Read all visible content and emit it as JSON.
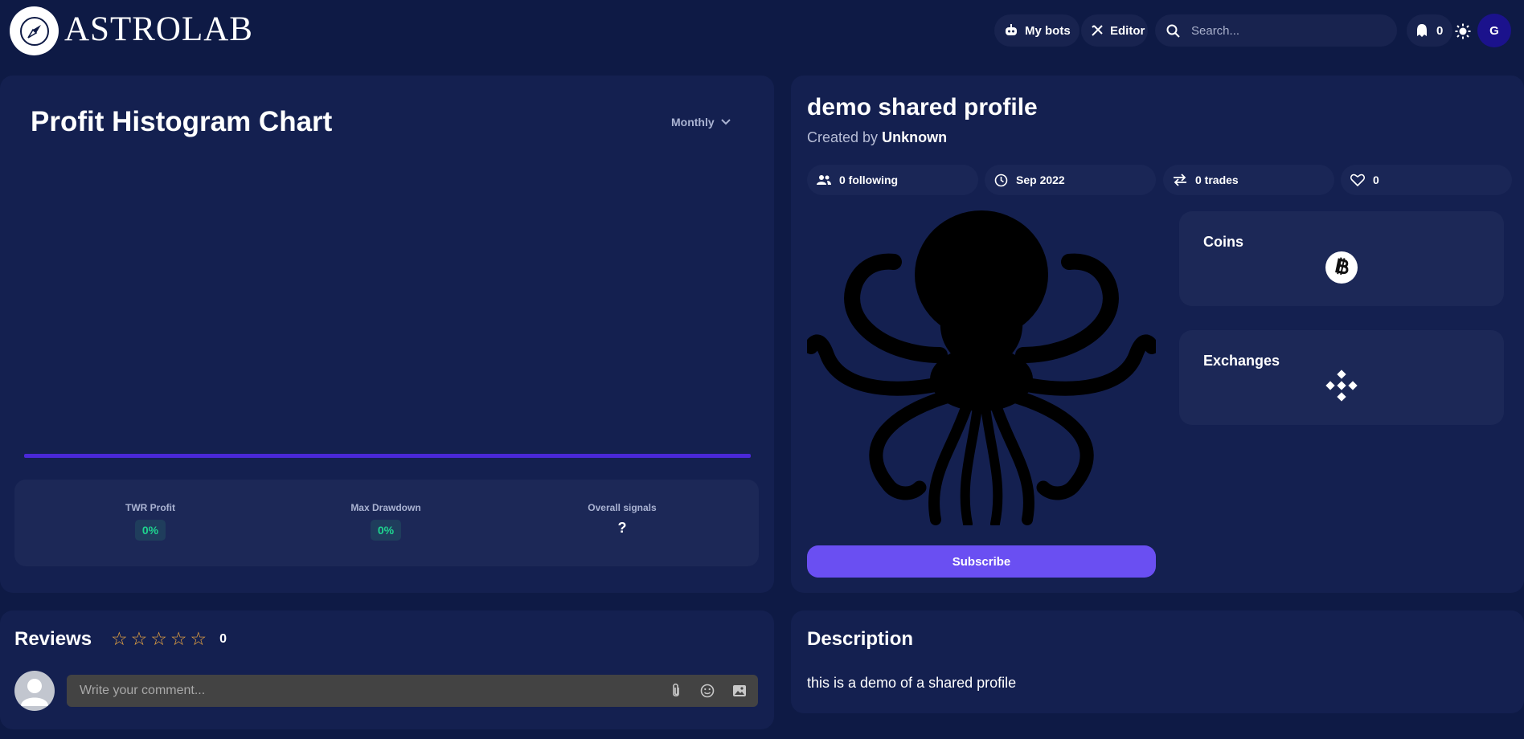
{
  "header": {
    "logo_text": "ASTROLAB",
    "my_bots_label": "My bots",
    "editor_label": "Editor",
    "search_placeholder": "Search...",
    "notification_count": "0",
    "avatar_initial": "G"
  },
  "chart_card": {
    "title": "Profit Histogram Chart",
    "period_select": "Monthly",
    "stats": [
      {
        "label": "TWR Profit",
        "value": "0%"
      },
      {
        "label": "Max Drawdown",
        "value": "0%"
      },
      {
        "label": "Overall signals",
        "value": "?"
      }
    ]
  },
  "chart_data": {
    "type": "bar",
    "title": "Profit Histogram Chart",
    "categories": [],
    "values": [],
    "xlabel": "",
    "ylabel": ""
  },
  "profile": {
    "title": "demo shared profile",
    "created_by_prefix": "Created by",
    "created_by_name": "Unknown",
    "following": "0 following",
    "date": "Sep 2022",
    "trades": "0 trades",
    "likes": "0",
    "coins_title": "Coins",
    "exchanges_title": "Exchanges",
    "coin_icon": "bitcoin-icon",
    "exchange_icon": "binance-icon",
    "subscribe_label": "Subscribe"
  },
  "reviews": {
    "title": "Reviews",
    "rating_count": "0",
    "comment_placeholder": "Write your comment..."
  },
  "description": {
    "title": "Description",
    "text": "this is a demo of a shared profile"
  },
  "colors": {
    "background": "#0e1a45",
    "card": "#142050",
    "accent": "#6a4ff2",
    "positive": "#1fd48f",
    "star": "#f0a940"
  }
}
